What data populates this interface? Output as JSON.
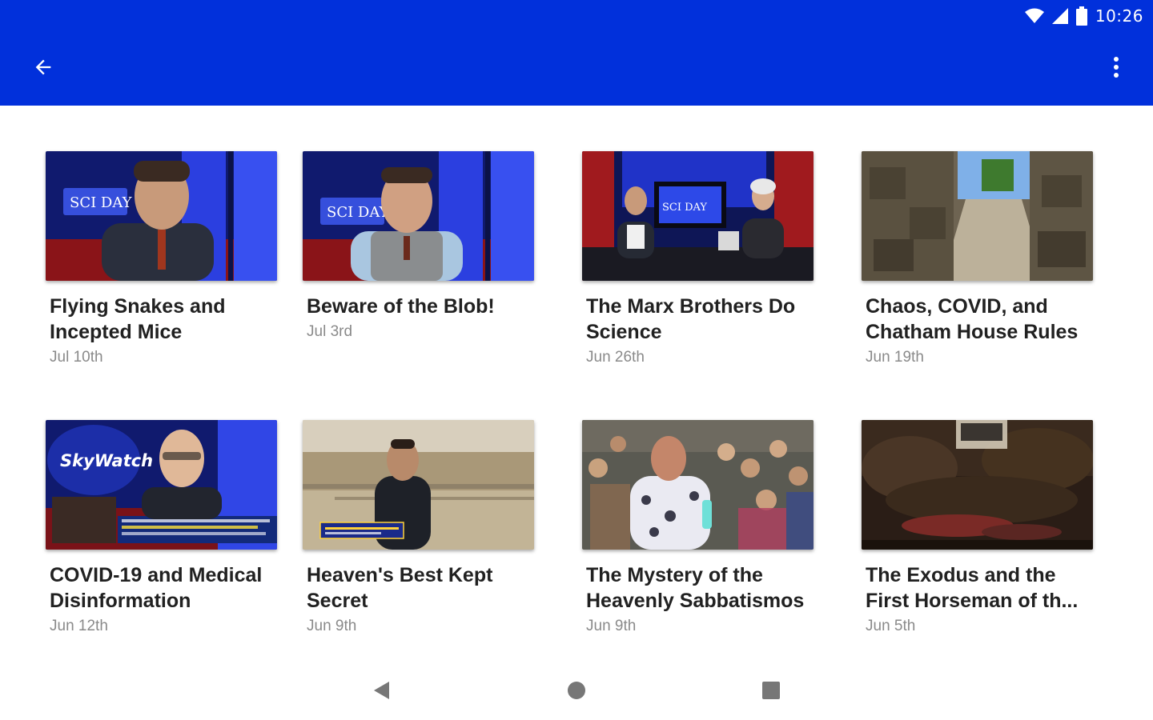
{
  "status_bar": {
    "time": "10:26",
    "icons": [
      "wifi-icon",
      "cell-signal-icon",
      "battery-icon"
    ]
  },
  "app_bar": {
    "back_icon": "arrow-back-icon",
    "overflow_icon": "more-vert-icon"
  },
  "videos": [
    {
      "title": "Flying Snakes and Incepted Mice",
      "date": "Jul 10th"
    },
    {
      "title": "Beware of the Blob!",
      "date": "Jul 3rd"
    },
    {
      "title": "The Marx Brothers Do Science",
      "date": "Jun 26th"
    },
    {
      "title": "Chaos, COVID, and Chatham House Rules",
      "date": "Jun 19th"
    },
    {
      "title": "COVID-19 and Medical Disinformation",
      "date": "Jun 12th"
    },
    {
      "title": "Heaven's Best Kept Secret",
      "date": "Jun 9th"
    },
    {
      "title": "The Mystery of the Heavenly Sabbatismos",
      "date": "Jun 9th"
    },
    {
      "title": "The Exodus and the First Horseman of th...",
      "date": "Jun 5th"
    }
  ],
  "thumbnail_text": {
    "studio_logo": "SCI DAY",
    "skywatch_logo": "SkyWatch"
  },
  "nav_bar": {
    "icons": [
      "back-triangle-icon",
      "home-circle-icon",
      "recents-square-icon"
    ]
  },
  "colors": {
    "primary": "#0130db",
    "title_text": "#212121",
    "date_text": "#8a8a8a"
  }
}
